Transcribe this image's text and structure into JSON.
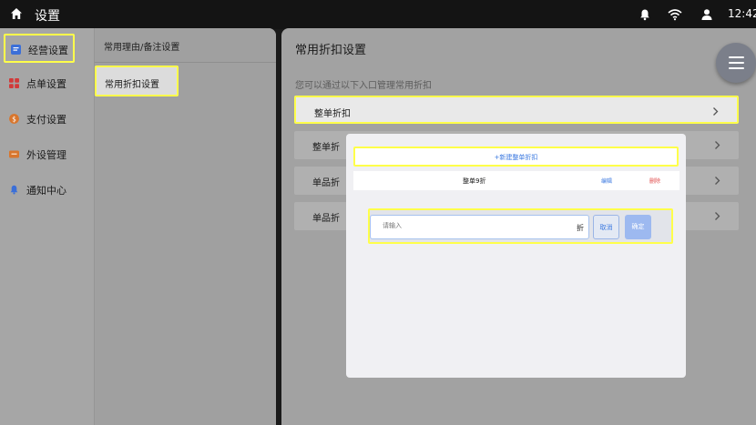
{
  "topbar": {
    "title": "设置",
    "time": "12:42",
    "icons": [
      "home-icon",
      "bell-icon",
      "wifi-icon",
      "user-icon"
    ]
  },
  "sidebar": {
    "items": [
      {
        "label": "经营设置",
        "icon": "document-icon",
        "color": "#3b6fd8",
        "selected": true
      },
      {
        "label": "点单设置",
        "icon": "grid-icon",
        "color": "#d23a3a"
      },
      {
        "label": "支付设置",
        "icon": "dollar-icon",
        "color": "#d8762e"
      },
      {
        "label": "外设管理",
        "icon": "device-icon",
        "color": "#d8762e"
      },
      {
        "label": "通知中心",
        "icon": "bell-icon",
        "color": "#3b6fd8"
      }
    ]
  },
  "subnav": {
    "header": "常用理由/备注设置",
    "selected": "常用折扣设置"
  },
  "main": {
    "title": "常用折扣设置",
    "hint": "您可以通过以下入口管理常用折扣",
    "rows": [
      "整单折扣",
      "整单折",
      "单品折",
      "单品折"
    ]
  },
  "modal": {
    "new_button": "+新建整单折扣",
    "item": {
      "name": "整单9折",
      "edit": "编辑",
      "delete": "删除"
    },
    "input": {
      "placeholder": "请输入",
      "value": "",
      "unit": "折"
    },
    "cancel": "取消",
    "confirm": "确定"
  },
  "colors": {
    "highlight": "#ffff4a",
    "accent": "#3a78e0",
    "danger": "#e04a4a"
  }
}
